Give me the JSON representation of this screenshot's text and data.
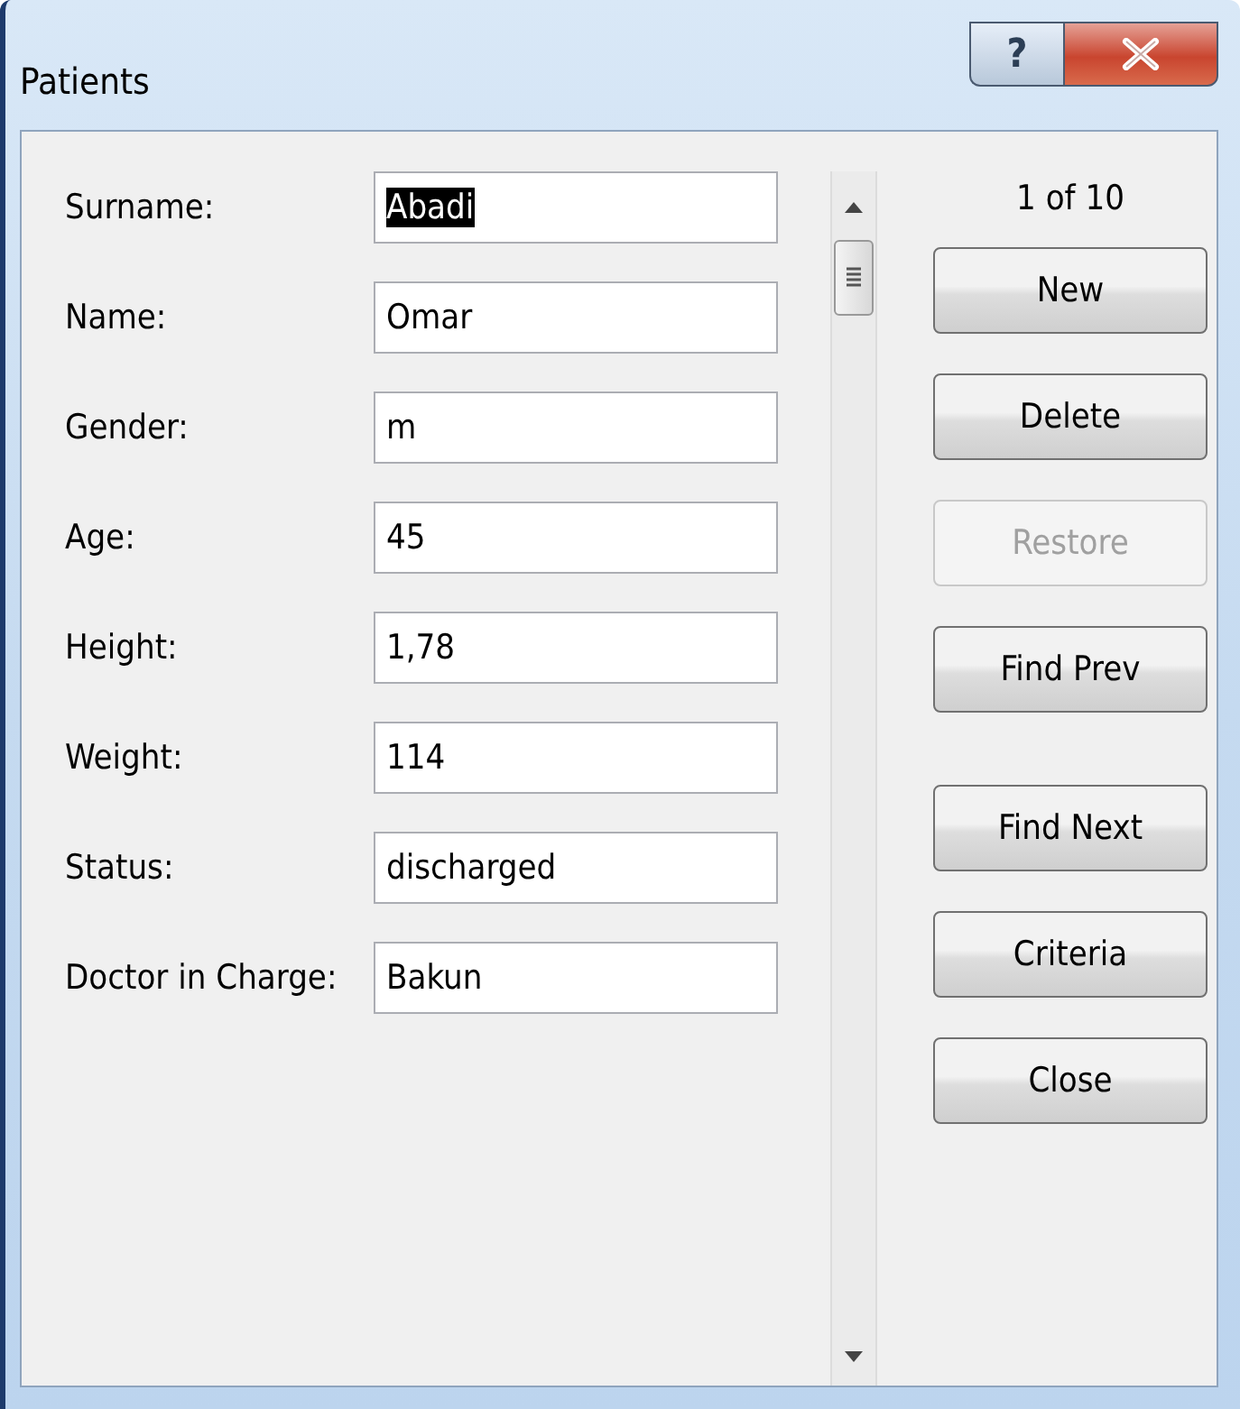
{
  "window": {
    "title": "Patients",
    "help_button": "?"
  },
  "fields": [
    {
      "label": "Surname:",
      "value": "Abadi",
      "selected": true
    },
    {
      "label": "Name:",
      "value": "Omar",
      "selected": false
    },
    {
      "label": "Gender:",
      "value": "m",
      "selected": false
    },
    {
      "label": "Age:",
      "value": "45",
      "selected": false
    },
    {
      "label": "Height:",
      "value": "1,78",
      "selected": false
    },
    {
      "label": "Weight:",
      "value": "114",
      "selected": false
    },
    {
      "label": "Status:",
      "value": "discharged",
      "selected": false
    },
    {
      "label": "Doctor in Charge:",
      "value": "Bakun",
      "selected": false
    }
  ],
  "record_counter": "1 of 10",
  "buttons": [
    {
      "label": "New",
      "disabled": false
    },
    {
      "label": "Delete",
      "disabled": false
    },
    {
      "label": "Restore",
      "disabled": true
    },
    {
      "label": "Find Prev",
      "disabled": false
    },
    {
      "label": "Find Next",
      "disabled": false
    },
    {
      "label": "Criteria",
      "disabled": false
    },
    {
      "label": "Close",
      "disabled": false
    }
  ]
}
